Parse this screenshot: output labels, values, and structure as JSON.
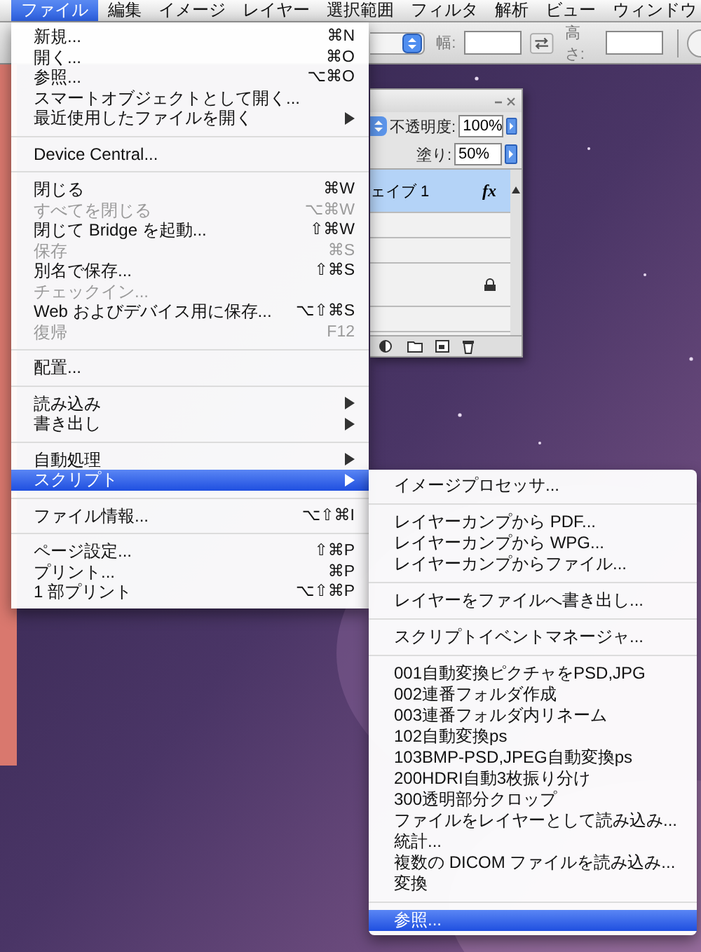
{
  "menubar": {
    "items": [
      {
        "label": "ファイル",
        "selected": true
      },
      {
        "label": "編集",
        "selected": false
      },
      {
        "label": "イメージ",
        "selected": false
      },
      {
        "label": "レイヤー",
        "selected": false
      },
      {
        "label": "選択範囲",
        "selected": false
      },
      {
        "label": "フィルタ",
        "selected": false
      },
      {
        "label": "解析",
        "selected": false
      },
      {
        "label": "ビュー",
        "selected": false
      },
      {
        "label": "ウィンドウ",
        "selected": false
      }
    ]
  },
  "options_bar": {
    "width_label": "幅:",
    "height_label": "高さ:"
  },
  "layers_panel": {
    "opacity_label": "不透明度:",
    "opacity": "100%",
    "fill_label": "塗り:",
    "fill": "50%",
    "layers": [
      {
        "kind": "layer",
        "name": "ェイブ 1",
        "selected": true,
        "effects_icon": "fx",
        "locked": false
      },
      {
        "kind": "layer",
        "selected": false,
        "locked": true
      }
    ]
  },
  "file_menu": {
    "items": [
      {
        "kind": "item",
        "label": "新規...",
        "shortcut": "⌘N",
        "disabled": false,
        "selected": false,
        "submenu": false
      },
      {
        "kind": "item",
        "label": "開く...",
        "shortcut": "⌘O",
        "disabled": false,
        "selected": false,
        "submenu": false
      },
      {
        "kind": "item",
        "label": "参照...",
        "shortcut": "⌥⌘O",
        "disabled": false,
        "selected": false,
        "submenu": false
      },
      {
        "kind": "item",
        "label": "スマートオブジェクトとして開く...",
        "disabled": false,
        "selected": false,
        "submenu": false
      },
      {
        "kind": "item",
        "label": "最近使用したファイルを開く",
        "disabled": false,
        "selected": false,
        "submenu": true
      },
      {
        "kind": "separator"
      },
      {
        "kind": "item",
        "label": "Device Central...",
        "disabled": false,
        "selected": false,
        "submenu": false
      },
      {
        "kind": "separator"
      },
      {
        "kind": "item",
        "label": "閉じる",
        "shortcut": "⌘W",
        "disabled": false,
        "selected": false,
        "submenu": false
      },
      {
        "kind": "item",
        "label": "すべてを閉じる",
        "shortcut": "⌥⌘W",
        "disabled": true,
        "selected": false,
        "submenu": false
      },
      {
        "kind": "item",
        "label": "閉じて Bridge を起動...",
        "shortcut": "⇧⌘W",
        "disabled": false,
        "selected": false,
        "submenu": false
      },
      {
        "kind": "item",
        "label": "保存",
        "shortcut": "⌘S",
        "disabled": true,
        "selected": false,
        "submenu": false
      },
      {
        "kind": "item",
        "label": "別名で保存...",
        "shortcut": "⇧⌘S",
        "disabled": false,
        "selected": false,
        "submenu": false
      },
      {
        "kind": "item",
        "label": "チェックイン...",
        "disabled": true,
        "selected": false,
        "submenu": false
      },
      {
        "kind": "item",
        "label": "Web およびデバイス用に保存...",
        "shortcut": "⌥⇧⌘S",
        "disabled": false,
        "selected": false,
        "submenu": false
      },
      {
        "kind": "item",
        "label": "復帰",
        "shortcut": "F12",
        "disabled": true,
        "selected": false,
        "submenu": false
      },
      {
        "kind": "separator"
      },
      {
        "kind": "item",
        "label": "配置...",
        "disabled": false,
        "selected": false,
        "submenu": false
      },
      {
        "kind": "separator"
      },
      {
        "kind": "item",
        "label": "読み込み",
        "disabled": false,
        "selected": false,
        "submenu": true
      },
      {
        "kind": "item",
        "label": "書き出し",
        "disabled": false,
        "selected": false,
        "submenu": true
      },
      {
        "kind": "separator"
      },
      {
        "kind": "item",
        "label": "自動処理",
        "disabled": false,
        "selected": false,
        "submenu": true
      },
      {
        "kind": "item",
        "label": "スクリプト",
        "disabled": false,
        "selected": true,
        "submenu": true
      },
      {
        "kind": "separator"
      },
      {
        "kind": "item",
        "label": "ファイル情報...",
        "shortcut": "⌥⇧⌘I",
        "disabled": false,
        "selected": false,
        "submenu": false
      },
      {
        "kind": "separator"
      },
      {
        "kind": "item",
        "label": "ページ設定...",
        "shortcut": "⇧⌘P",
        "disabled": false,
        "selected": false,
        "submenu": false
      },
      {
        "kind": "item",
        "label": "プリント...",
        "shortcut": "⌘P",
        "disabled": false,
        "selected": false,
        "submenu": false
      },
      {
        "kind": "item",
        "label": "1 部プリント",
        "shortcut": "⌥⇧⌘P",
        "disabled": false,
        "selected": false,
        "submenu": false
      }
    ]
  },
  "script_submenu": {
    "items": [
      {
        "kind": "item",
        "label": "イメージプロセッサ...",
        "disabled": false,
        "selected": false
      },
      {
        "kind": "separator"
      },
      {
        "kind": "item",
        "label": "レイヤーカンプから PDF...",
        "disabled": false,
        "selected": false
      },
      {
        "kind": "item",
        "label": "レイヤーカンプから WPG...",
        "disabled": false,
        "selected": false
      },
      {
        "kind": "item",
        "label": "レイヤーカンプからファイル...",
        "disabled": false,
        "selected": false
      },
      {
        "kind": "separator"
      },
      {
        "kind": "item",
        "label": "レイヤーをファイルへ書き出し...",
        "disabled": false,
        "selected": false
      },
      {
        "kind": "separator"
      },
      {
        "kind": "item",
        "label": "スクリプトイベントマネージャ...",
        "disabled": false,
        "selected": false
      },
      {
        "kind": "separator"
      },
      {
        "kind": "item",
        "label": "001自動変換ピクチャをPSD,JPG",
        "disabled": false,
        "selected": false
      },
      {
        "kind": "item",
        "label": "002連番フォルダ作成",
        "disabled": false,
        "selected": false
      },
      {
        "kind": "item",
        "label": "003連番フォルダ内リネーム",
        "disabled": false,
        "selected": false
      },
      {
        "kind": "item",
        "label": "102自動変換ps",
        "disabled": false,
        "selected": false
      },
      {
        "kind": "item",
        "label": "103BMP-PSD,JPEG自動変換ps",
        "disabled": false,
        "selected": false
      },
      {
        "kind": "item",
        "label": "200HDRI自動3枚振り分け",
        "disabled": false,
        "selected": false
      },
      {
        "kind": "item",
        "label": "300透明部分クロップ",
        "disabled": false,
        "selected": false
      },
      {
        "kind": "item",
        "label": "ファイルをレイヤーとして読み込み...",
        "disabled": false,
        "selected": false
      },
      {
        "kind": "item",
        "label": "統計...",
        "disabled": false,
        "selected": false
      },
      {
        "kind": "item",
        "label": "複数の DICOM ファイルを読み込み...",
        "disabled": false,
        "selected": false
      },
      {
        "kind": "item",
        "label": "変換",
        "disabled": false,
        "selected": false
      },
      {
        "kind": "separator"
      },
      {
        "kind": "item",
        "label": "参照...",
        "disabled": false,
        "selected": true
      }
    ]
  }
}
